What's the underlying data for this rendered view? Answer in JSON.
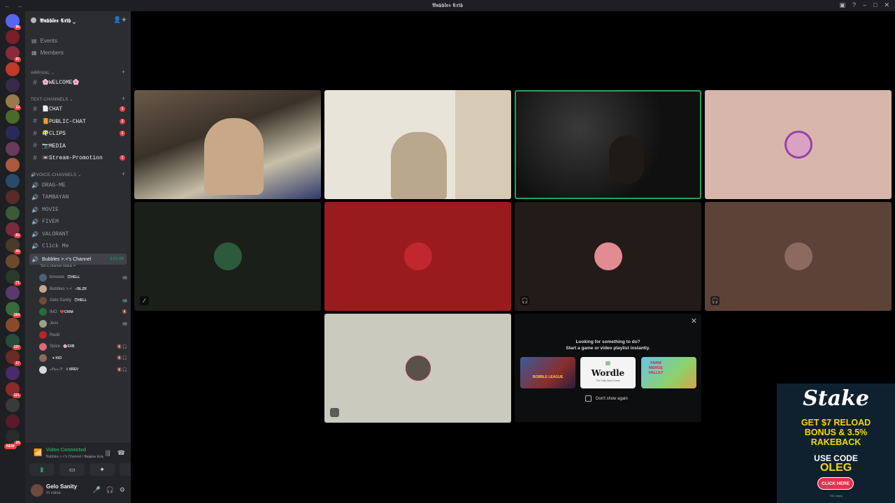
{
  "window": {
    "title": "𝕭𝖚𝖇𝖇𝖑𝖊𝖘 𝕮𝖗𝖎𝖇",
    "nav": "← →"
  },
  "guild": {
    "name": "𝕭𝖚𝖇𝖇𝖑𝖊𝖘 𝕮𝖗𝖎𝖇 ⌄"
  },
  "top_links": [
    "Events",
    "Members"
  ],
  "categories": {
    "arrival": "ARRIVAL ⌄",
    "text": "TEXT-CHANNELS ⌄",
    "voice": "🔊VOICE-CHANNELS ⌄"
  },
  "welcome": "🌸WELCOME🌸",
  "text_channels": [
    {
      "name": "📄CHAT",
      "badge": "1"
    },
    {
      "name": "📙PUBLIC-CHAT",
      "badge": "2"
    },
    {
      "name": "😶‍🌫️CLIPS",
      "badge": "1"
    },
    {
      "name": "📷MEDIA",
      "badge": ""
    },
    {
      "name": "📼Stream-Promotion",
      "badge": "1"
    }
  ],
  "voice_channels": [
    "DRAG-ME",
    "TAMBAYAN",
    "MOVIE",
    "FIVEM",
    "VALORANT",
    "Click Me"
  ],
  "active_voice": {
    "name": "Bubbles >.<'s Channel",
    "timer": "3:01:04",
    "status": "Set a channel status ✏"
  },
  "voice_users": [
    {
      "name": "binseee",
      "tag": "😈HELL",
      "icons": "📹",
      "color": "#4a6278"
    },
    {
      "name": "Bubbles >.<",
      "tag": "⚡BLZR",
      "icons": "",
      "color": "#c9a58e"
    },
    {
      "name": "Gelo Sanity",
      "tag": "😈HELL",
      "icons": "📹",
      "color": "#6d4a3c"
    },
    {
      "name": "INO",
      "tag": "💔CRIM",
      "icons": "🔇",
      "color": "#2b6b3a"
    },
    {
      "name": "Jess",
      "tag": "",
      "icons": "📹",
      "color": "#9aa08a"
    },
    {
      "name": "Redd",
      "tag": "",
      "icons": "",
      "color": "#b8242c"
    },
    {
      "name": "Spice",
      "tag": "🌸SXB",
      "icons": "🔇🎧",
      "color": "#d86a7a"
    },
    {
      "name": "",
      "tag": "♥ KIO",
      "icons": "🔇🎧",
      "color": "#8b6a5a"
    },
    {
      "name": "𝒩𝑜𝒾𝓇-𝒱",
      "tag": "⸸ XREV",
      "icons": "🔇🎧",
      "color": "#d8d8d8"
    }
  ],
  "voice_panel": {
    "status": "Video Connected",
    "sub": "Bubbles >.<'s Channel / 𝕭𝖚𝖇𝖇𝖑𝖊𝖘 𝕮𝖗𝖎𝖇"
  },
  "user": {
    "name": "Gelo Sanity",
    "status": "In voice"
  },
  "activity": {
    "title_line1": "Looking for something to do?",
    "title_line2": "Start a game or video playlist instantly.",
    "cards": [
      {
        "label": "BOBBLE LEAGUE"
      },
      {
        "label": "Wordle",
        "sub": "The Daily Word Game"
      },
      {
        "label": "FARM MERGE VALLEY"
      }
    ],
    "checkbox": "Don't show again"
  },
  "ad": {
    "logo": "Stake",
    "line1": "GET $7 RELOAD",
    "line2": "BONUS & 3.5%",
    "line3": "RAKEBACK",
    "code_label": "USE CODE",
    "code": "OLEG",
    "button": "CLICK HERE",
    "fine": "T&C apply"
  },
  "server_badges": [
    "96",
    "",
    "87",
    "",
    "",
    "12",
    "",
    "",
    "",
    "",
    "",
    "",
    "",
    "83",
    "43",
    "",
    "71",
    "",
    "164",
    "",
    "137",
    "17",
    "",
    "121",
    "",
    "",
    "24"
  ],
  "new_label": "NEW"
}
